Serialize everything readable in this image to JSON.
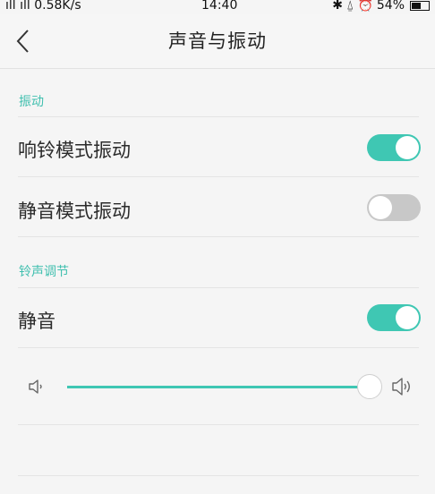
{
  "status_bar": {
    "signal_text": "ᵀᴺ .ıl .ıl",
    "network_speed": "0.58K/s",
    "time": "14:40",
    "icons_text": "✶ 🔕 ⏰",
    "battery": "54%"
  },
  "header": {
    "title": "声音与振动"
  },
  "sections": {
    "vibration": {
      "label": "振动",
      "ring_vibrate": {
        "label": "响铃模式振动",
        "enabled": true
      },
      "silent_vibrate": {
        "label": "静音模式振动",
        "enabled": false
      }
    },
    "ringtone": {
      "label": "铃声调节",
      "mute": {
        "label": "静音",
        "enabled": true
      },
      "volume_level": 0.98
    }
  },
  "colors": {
    "accent": "#3fc7b3",
    "section_label": "#3fbfae",
    "toggle_off": "#c8c8c8"
  }
}
